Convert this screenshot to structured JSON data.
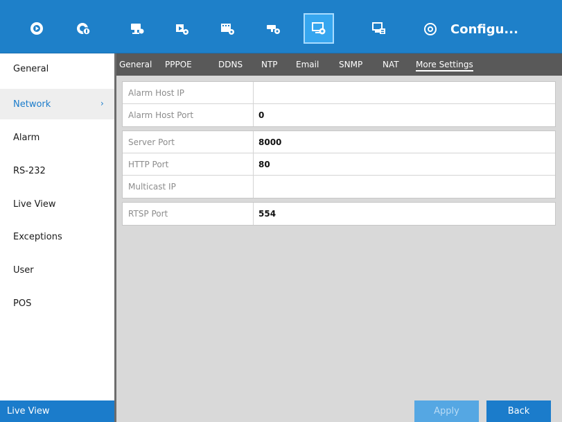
{
  "toolbar": {
    "title": "Configu...",
    "icons": [
      "playback-icon",
      "manual-icon",
      "camera-settings-icon",
      "record-settings-icon",
      "video-settings-icon",
      "network-camera-icon",
      "system-configuration-icon",
      "storage-icon",
      "shutdown-icon"
    ]
  },
  "sidebar": {
    "items": [
      {
        "label": "General"
      },
      {
        "label": "Network"
      },
      {
        "label": "Alarm"
      },
      {
        "label": "RS-232"
      },
      {
        "label": "Live View"
      },
      {
        "label": "Exceptions"
      },
      {
        "label": "User"
      },
      {
        "label": "POS"
      }
    ],
    "active": "Network",
    "bottom_label": "Live View"
  },
  "tabs": [
    {
      "label": "General"
    },
    {
      "label": "PPPOE"
    },
    {
      "label": "DDNS"
    },
    {
      "label": "NTP"
    },
    {
      "label": "Email"
    },
    {
      "label": "SNMP"
    },
    {
      "label": "NAT"
    },
    {
      "label": "More Settings"
    }
  ],
  "active_tab": "More Settings",
  "fields": {
    "alarm_host_ip": {
      "label": "Alarm Host IP",
      "value": ""
    },
    "alarm_host_port": {
      "label": "Alarm Host Port",
      "value": "0"
    },
    "server_port": {
      "label": "Server Port",
      "value": "8000"
    },
    "http_port": {
      "label": "HTTP Port",
      "value": "80"
    },
    "multicast_ip": {
      "label": "Multicast IP",
      "value": ""
    },
    "rtsp_port": {
      "label": "RTSP Port",
      "value": "554"
    }
  },
  "buttons": {
    "apply": "Apply",
    "back": "Back"
  },
  "colors": {
    "toolbar_bg": "#1e80c9",
    "active_blue": "#1b7ccb",
    "tab_bar": "#595959",
    "content_bg": "#d9d9d9"
  }
}
